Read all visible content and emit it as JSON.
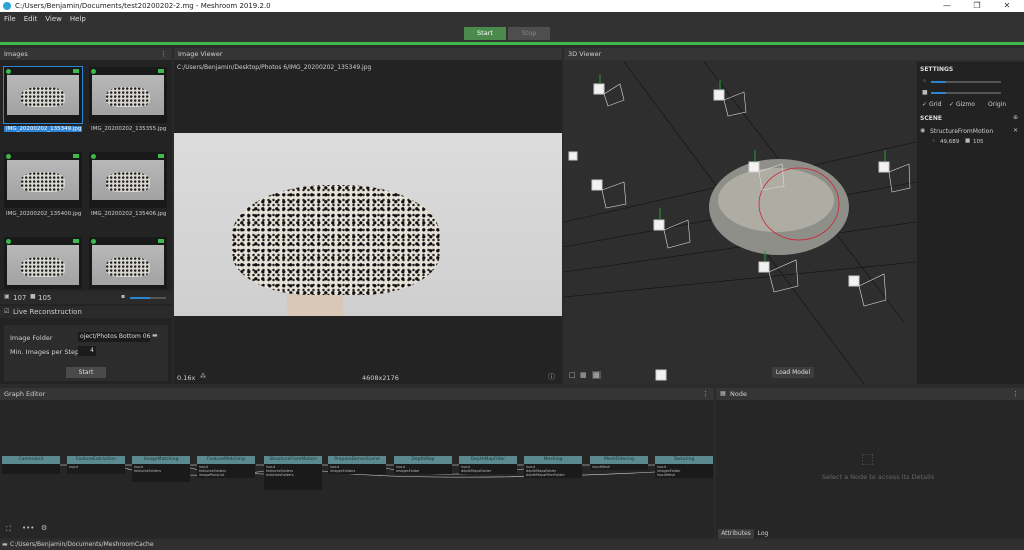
{
  "window": {
    "title": "C:/Users/Benjamin/Documents/test20200202-2.mg - Meshroom 2019.2.0",
    "minimize": "—",
    "maximize": "❐",
    "close": "✕"
  },
  "menu": [
    "File",
    "Edit",
    "View",
    "Help"
  ],
  "toolbar": {
    "start": "Start",
    "stop": "Stop"
  },
  "images_panel": {
    "title": "Images",
    "thumbnails": [
      {
        "name": "IMG_20200202_135349.jpg",
        "selected": true
      },
      {
        "name": "IMG_20200202_135355.jpg",
        "selected": false
      },
      {
        "name": "IMG_20200202_135400.jpg",
        "selected": false
      },
      {
        "name": "IMG_20200202_135406.jpg",
        "selected": false
      },
      {
        "name": "",
        "selected": false
      },
      {
        "name": "",
        "selected": false
      }
    ],
    "image_count": "107",
    "camera_count": "105",
    "live_reconstruction": "Live Reconstruction",
    "image_folder_label": "Image Folder",
    "image_folder_value": "oject/Photos Bottom 06",
    "min_images_label": "Min. Images per Step",
    "min_images_value": "4",
    "start": "Start"
  },
  "image_viewer": {
    "title": "Image Viewer",
    "path": "C:/Users/Benjamin/Desktop/Photos 6/IMG_20200202_135349.jpg",
    "zoom": "0.16x",
    "resolution": "4608x2176"
  },
  "viewer3d": {
    "title": "3D Viewer",
    "load_model": "Load Model",
    "settings_title": "SETTINGS",
    "grid": "Grid",
    "gizmo": "Gizmo",
    "origin": "Origin",
    "scene_title": "SCENE",
    "scene_item": "StructureFromMotion",
    "points": "49,689",
    "cameras": "105"
  },
  "graph_editor": {
    "title": "Graph Editor",
    "nodes": [
      {
        "name": "CameraInit",
        "ports": [
          "",
          ""
        ]
      },
      {
        "name": "FeatureExtraction",
        "ports": [
          "input",
          ""
        ]
      },
      {
        "name": "ImageMatching",
        "ports": [
          "input",
          "featuresFolders",
          "",
          ""
        ]
      },
      {
        "name": "FeatureMatching",
        "ports": [
          "input",
          "featuresFolders",
          "imagePairsList"
        ]
      },
      {
        "name": "StructureFromMotion",
        "ports": [
          "input",
          "featuresFolders",
          "matchesFolders",
          "",
          "",
          ""
        ]
      },
      {
        "name": "PrepareDenseScene",
        "ports": [
          "input",
          "imagesFolders"
        ]
      },
      {
        "name": "DepthMap",
        "ports": [
          "input",
          "imagesFolder"
        ]
      },
      {
        "name": "DepthMapFilter",
        "ports": [
          "input",
          "depthMapsFolder"
        ]
      },
      {
        "name": "Meshing",
        "ports": [
          "input",
          "depthMapsFolder",
          "depthMapsFilterFolder"
        ]
      },
      {
        "name": "MeshFiltering",
        "ports": [
          "inputMesh"
        ]
      },
      {
        "name": "Texturing",
        "ports": [
          "input",
          "imagesFolder",
          "inputMesh"
        ]
      }
    ]
  },
  "node_panel": {
    "title": "Node",
    "placeholder": "Select a Node to access its Details",
    "tab_attributes": "Attributes",
    "tab_log": "Log"
  },
  "statusbar": {
    "path": "C:/Users/Benjamin/Documents/MeshroomCache"
  }
}
